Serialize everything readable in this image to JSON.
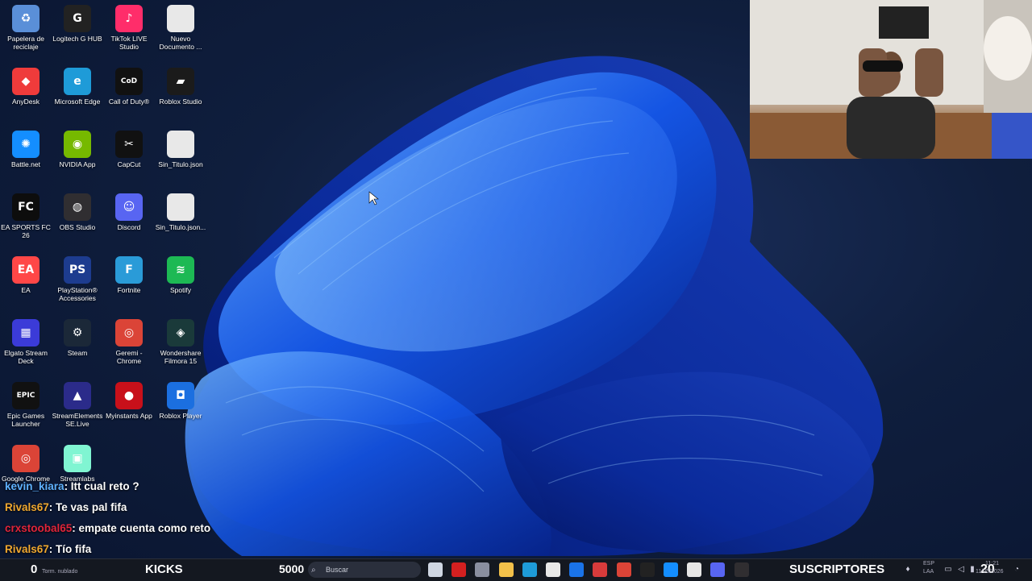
{
  "desktop": {
    "icons": [
      {
        "label": "Papelera de reciclaje",
        "icon": "recycle-bin-icon",
        "color": "#5a8fd8"
      },
      {
        "label": "Logitech G HUB",
        "icon": "logitech-icon",
        "color": "#222222"
      },
      {
        "label": "TikTok LIVE Studio",
        "icon": "tiktok-icon",
        "color": "#ff2d6a"
      },
      {
        "label": "Nuevo Documento ...",
        "icon": "document-icon",
        "color": "#e8e8e8"
      },
      {
        "label": "AnyDesk",
        "icon": "anydesk-icon",
        "color": "#ef3b3b"
      },
      {
        "label": "Microsoft Edge",
        "icon": "edge-icon",
        "color": "#1e9bd8"
      },
      {
        "label": "Call of Duty®",
        "icon": "call-of-duty-icon",
        "color": "#111111"
      },
      {
        "label": "Roblox Studio",
        "icon": "roblox-studio-icon",
        "color": "#1b1b1b"
      },
      {
        "label": "Battle.net",
        "icon": "battlenet-icon",
        "color": "#148eff"
      },
      {
        "label": "NVIDIA App",
        "icon": "nvidia-icon",
        "color": "#76b900"
      },
      {
        "label": "CapCut",
        "icon": "capcut-icon",
        "color": "#111111"
      },
      {
        "label": "Sin_Titulo.json",
        "icon": "json-file-icon",
        "color": "#e8e8e8"
      },
      {
        "label": "EA SPORTS FC 26",
        "icon": "easports-fc-icon",
        "color": "#0d0d0d"
      },
      {
        "label": "OBS Studio",
        "icon": "obs-icon",
        "color": "#302e31"
      },
      {
        "label": "Discord",
        "icon": "discord-icon",
        "color": "#5865f2"
      },
      {
        "label": "Sin_Titulo.json...",
        "icon": "json-file-icon",
        "color": "#e8e8e8"
      },
      {
        "label": "EA",
        "icon": "ea-icon",
        "color": "#ff4747"
      },
      {
        "label": "PlayStation® Accessories",
        "icon": "playstation-icon",
        "color": "#1d3c8f"
      },
      {
        "label": "Fortnite",
        "icon": "fortnite-icon",
        "color": "#2a9bd8"
      },
      {
        "label": "Spotify",
        "icon": "spotify-icon",
        "color": "#1db954"
      },
      {
        "label": "Elgato Stream Deck",
        "icon": "stream-deck-icon",
        "color": "#3b3bd8"
      },
      {
        "label": "Steam",
        "icon": "steam-icon",
        "color": "#1b2838"
      },
      {
        "label": "Geremi - Chrome",
        "icon": "chrome-icon",
        "color": "#db4437"
      },
      {
        "label": "Wondershare Filmora 15",
        "icon": "filmora-icon",
        "color": "#1a3a3a"
      },
      {
        "label": "Epic Games Launcher",
        "icon": "epic-games-icon",
        "color": "#111111"
      },
      {
        "label": "StreamElements SE.Live",
        "icon": "streamelements-icon",
        "color": "#2b2b8a"
      },
      {
        "label": "Myinstants App",
        "icon": "myinstants-icon",
        "color": "#c8101a"
      },
      {
        "label": "Roblox Player",
        "icon": "roblox-player-icon",
        "color": "#1b6fe0"
      },
      {
        "label": "Google Chrome",
        "icon": "chrome-icon",
        "color": "#db4437"
      },
      {
        "label": "Streamlabs",
        "icon": "streamlabs-icon",
        "color": "#80f5d2"
      }
    ]
  },
  "chat": {
    "messages": [
      {
        "user": "kevin_kiara",
        "text": ": Itt cual reto ?"
      },
      {
        "user": "Rivals67",
        "text": ": Te vas pal fifa"
      },
      {
        "user": "crxstoobal65",
        "text": ": empate cuenta como reto"
      },
      {
        "user": "Rivals67",
        "text": ": Tío fifa"
      }
    ]
  },
  "taskbar": {
    "left_counter": "0",
    "kicks_label": "KICKS",
    "weather_text": "Torm. nublado",
    "kicks_count": "5000",
    "search_placeholder": "Buscar",
    "subs_label": "SUSCRIPTORES",
    "subs_count": "20",
    "lang": "ESP",
    "lang_sub": "LAA",
    "time": "11:21",
    "date": "11/05/2026",
    "apps": [
      {
        "icon": "taskbar-file-icon",
        "color": "#cfd6e2"
      },
      {
        "icon": "taskbar-recorder-icon",
        "color": "#d42020"
      },
      {
        "icon": "taskbar-box-icon",
        "color": "#8a8fa0"
      },
      {
        "icon": "file-explorer-icon",
        "color": "#f2c04a"
      },
      {
        "icon": "edge-taskbar-icon",
        "color": "#1e9bd8"
      },
      {
        "icon": "store-icon",
        "color": "#e8e8e8"
      },
      {
        "icon": "mail-icon",
        "color": "#1a73e8"
      },
      {
        "icon": "news-icon",
        "color": "#d83b3b"
      },
      {
        "icon": "chrome-taskbar-icon",
        "color": "#db4437"
      },
      {
        "icon": "epic-taskbar-icon",
        "color": "#222222"
      },
      {
        "icon": "battlenet-taskbar-icon",
        "color": "#148eff"
      },
      {
        "icon": "xbox-taskbar-icon",
        "color": "#e6e6e6"
      },
      {
        "icon": "discord-taskbar-icon",
        "color": "#5865f2"
      },
      {
        "icon": "obs-taskbar-icon",
        "color": "#302e31"
      }
    ]
  }
}
